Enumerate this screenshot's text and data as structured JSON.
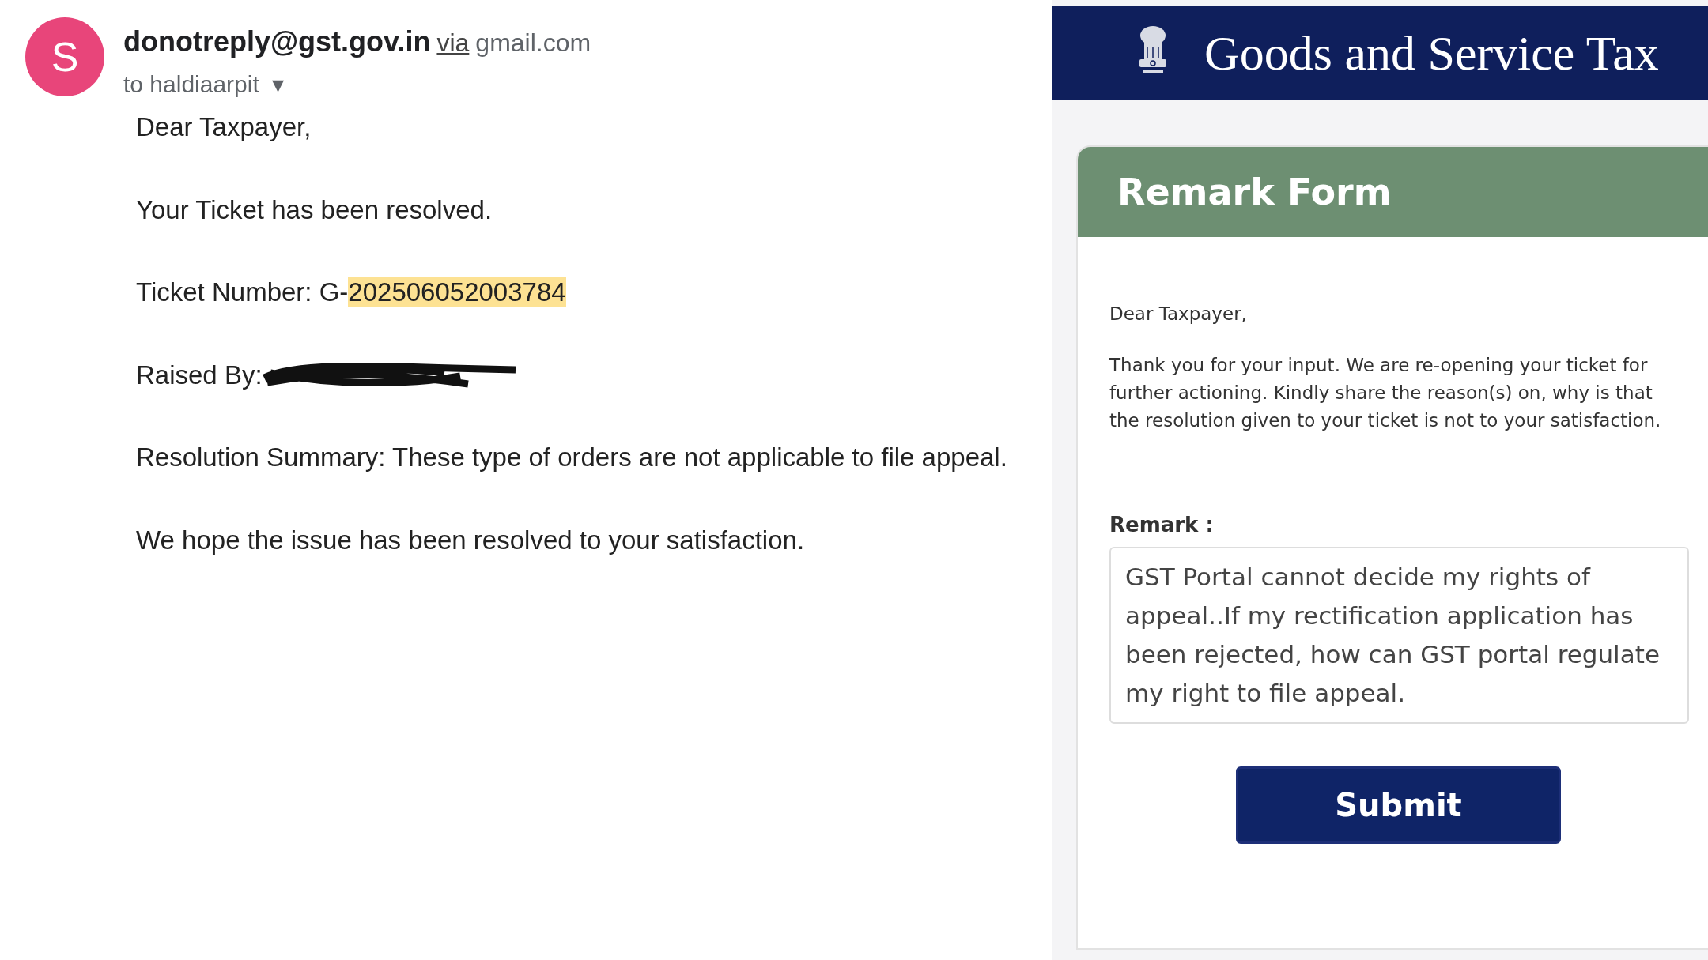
{
  "email": {
    "avatar_letter": "S",
    "sender": "donotreply@gst.gov.in",
    "via": "via",
    "via_domain": "gmail.com",
    "recipient": "to haldiaarpit",
    "dropdown": "▾",
    "body": [
      {
        "kind": "text",
        "text": "Dear Taxpayer,"
      },
      {
        "kind": "text",
        "text": "Your Ticket has been resolved."
      },
      {
        "kind": "highlight",
        "text": "Ticket Number: G-",
        "highlighted_text": "202506052003784",
        "highlighted": true
      },
      {
        "kind": "redacted",
        "text": "Raised By:",
        "redacted": true
      },
      {
        "kind": "text",
        "text": "Resolution Summary: These type of orders are not applicable to file appeal."
      },
      {
        "kind": "text",
        "text": "We hope the issue has been resolved to your satisfaction."
      }
    ]
  },
  "portal": {
    "title": "Goods and Service Tax",
    "form": {
      "title": "Remark Form",
      "greeting": "Dear Taxpayer,",
      "message": "Thank you for your input. We are re-opening your ticket for further actioning. Kindly share the reason(s) on, why is that the resolution given to your ticket is not to your satisfaction.",
      "remark_label": "Remark :",
      "remark_value": "GST Portal cannot decide my rights of appeal..If my rectification application has been rejected, how can GST portal regulate my right to file appeal.",
      "submit": "Submit"
    }
  }
}
